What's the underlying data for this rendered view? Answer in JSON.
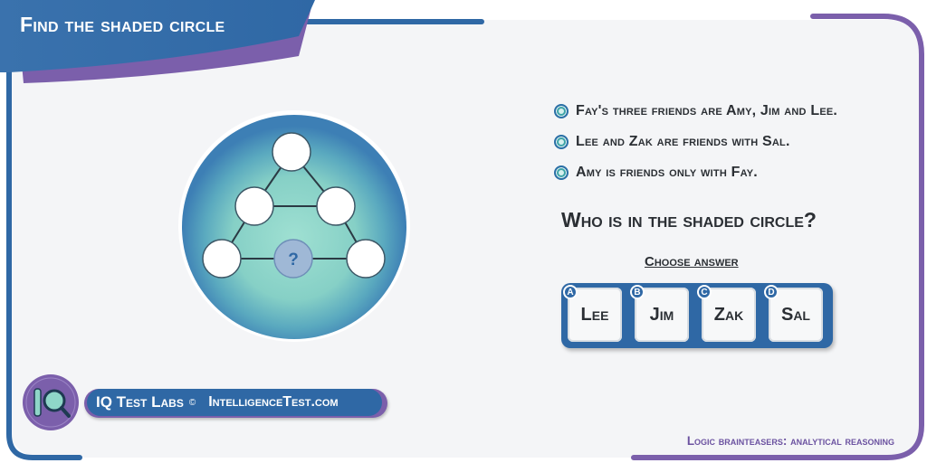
{
  "header": {
    "title": "Find the shaded circle"
  },
  "puzzle": {
    "center_symbol": "?"
  },
  "clues": [
    "Fay's three friends are Amy, Jim and Lee.",
    "Lee and Zak are friends with Sal.",
    "Amy is friends only with Fay."
  ],
  "question": "Who is in the shaded circle?",
  "choose_label": "Choose answer",
  "answers": [
    {
      "letter": "A",
      "label": "Lee"
    },
    {
      "letter": "B",
      "label": "Jim"
    },
    {
      "letter": "C",
      "label": "Zak"
    },
    {
      "letter": "D",
      "label": "Sal"
    }
  ],
  "brand": {
    "name": "IQ Test Labs",
    "copyright": "©",
    "site": "IntelligenceTest.com"
  },
  "footer": "Logic brainteasers: analytical reasoning",
  "colors": {
    "blue": "#2f68a5",
    "purple": "#7b5fab",
    "teal": "#8fd6c8",
    "panel": "#f4f5f7"
  },
  "icons": {
    "logo": "iq-magnifier-icon",
    "bullet": "bullet-circle-icon"
  }
}
